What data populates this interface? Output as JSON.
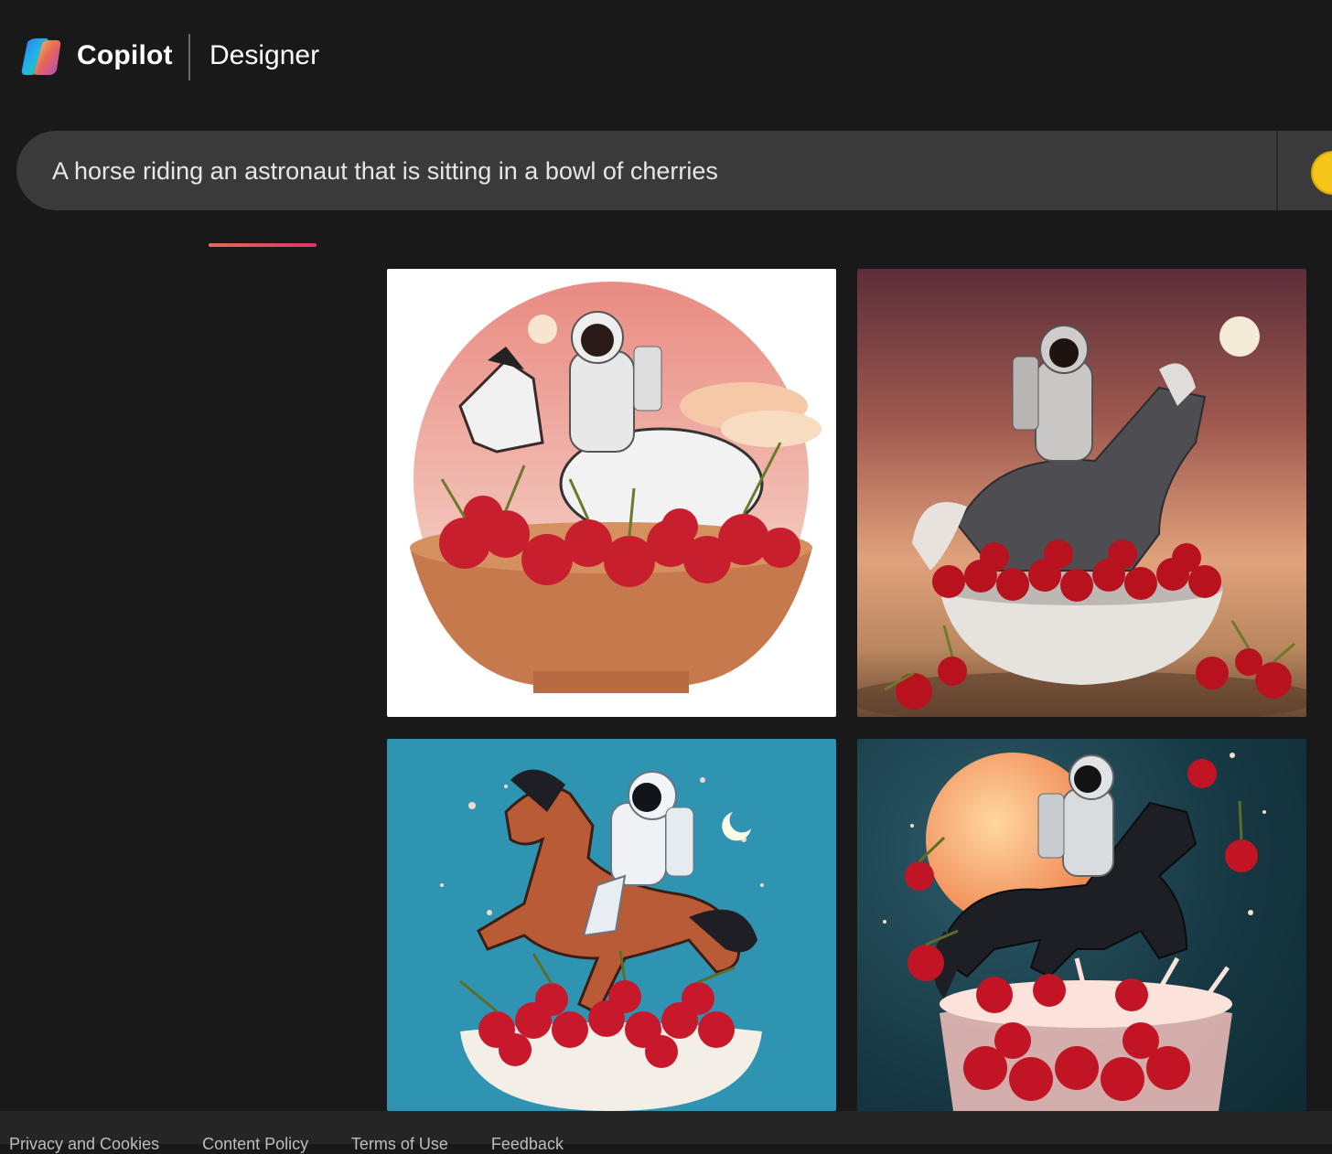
{
  "header": {
    "brand": "Copilot",
    "product": "Designer",
    "logo_icon": "copilot-logo-icon"
  },
  "search": {
    "prompt": "A horse riding an astronaut that is sitting in a bowl of cherries",
    "boost_icon": "boost-coin-icon"
  },
  "results": {
    "images": [
      {
        "icon": "generated-image-1"
      },
      {
        "icon": "generated-image-2"
      },
      {
        "icon": "generated-image-3"
      },
      {
        "icon": "generated-image-4"
      }
    ]
  },
  "footer": {
    "links": [
      "Privacy and Cookies",
      "Content Policy",
      "Terms of Use",
      "Feedback"
    ]
  },
  "colors": {
    "background": "#1a1919",
    "searchbar": "#3b3a3a",
    "accent_start": "#e96a52",
    "accent_end": "#d9356e"
  }
}
